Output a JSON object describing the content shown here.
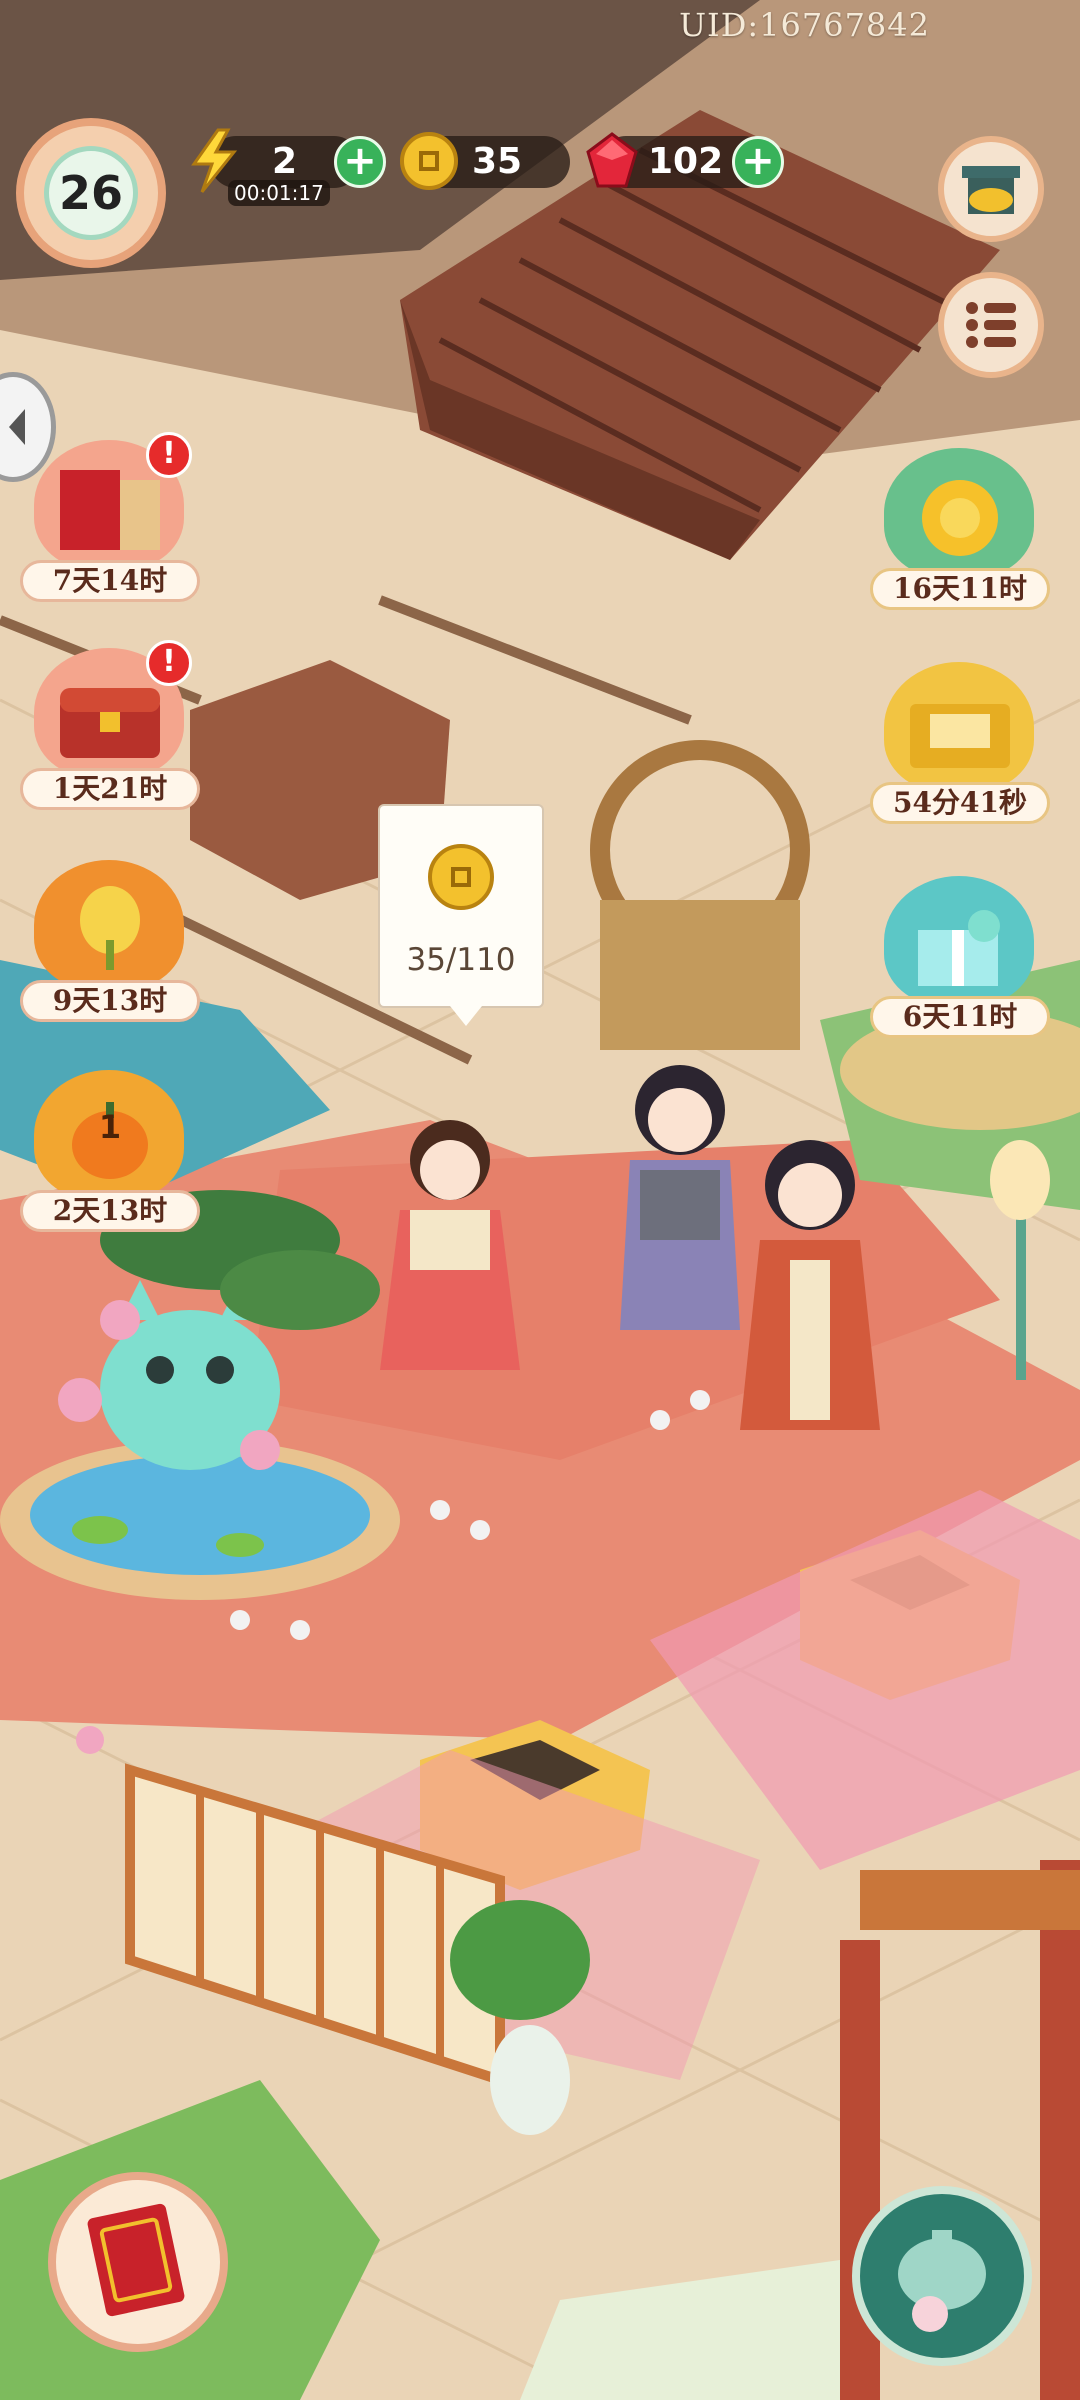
{
  "uid": "UID:16767842",
  "player": {
    "level": "26"
  },
  "resources": {
    "energy": {
      "icon": "lightning-icon",
      "value": "2",
      "timer": "00:01:17"
    },
    "coins": {
      "icon": "coin-icon",
      "value": "35"
    },
    "gems": {
      "icon": "ruby-icon",
      "value": "102"
    }
  },
  "events_left": [
    {
      "name": "scroll-gift-event",
      "time": "7天14时",
      "alert": "!"
    },
    {
      "name": "treasure-chest-event",
      "time": "1天21时",
      "alert": "!"
    },
    {
      "name": "wheat-harvest-event",
      "time": "9天13时"
    },
    {
      "name": "pumpkin-event",
      "time": "2天13时",
      "count": "1"
    }
  ],
  "events_right": [
    {
      "name": "chrysanthemum-event",
      "time": "16天11时"
    },
    {
      "name": "golden-box-event",
      "time": "54分41秒"
    },
    {
      "name": "gift-box-event",
      "time": "6天11时"
    }
  ],
  "coin_tooltip": {
    "progress": "35/110"
  },
  "colors": {
    "accent_green": "#38b25a",
    "alert_red": "#e62b2b",
    "label_text": "#5a2b1c"
  }
}
